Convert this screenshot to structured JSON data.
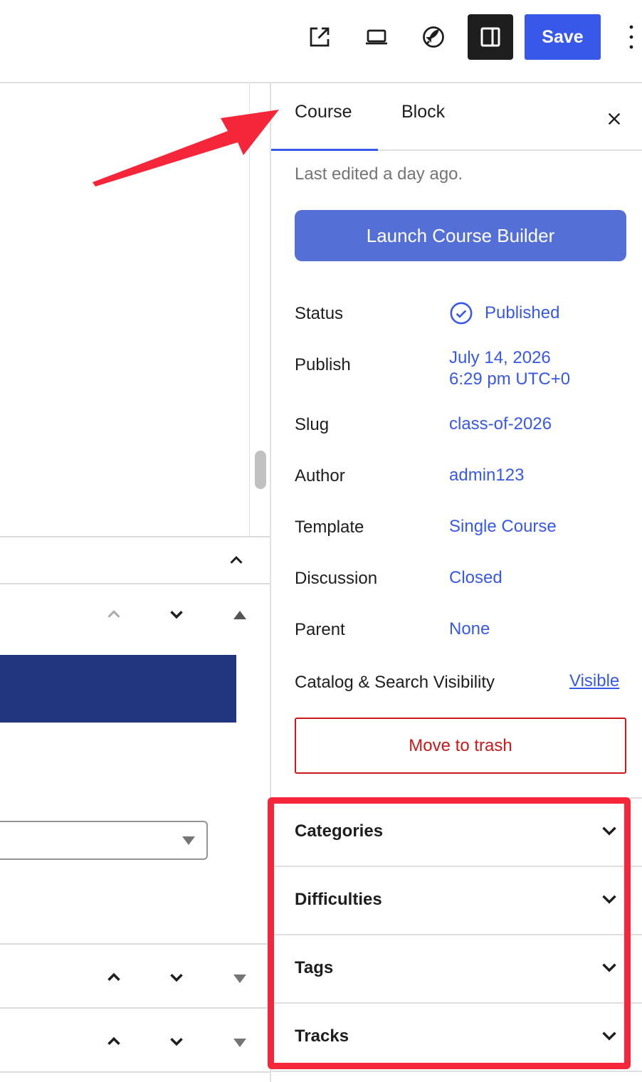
{
  "toolbar": {
    "view_icon": "external-link-icon",
    "preview_icon": "laptop-icon",
    "launchpad_icon": "rocket-icon",
    "settings_icon": "sidebar-toggle-icon",
    "save_label": "Save",
    "more_icon": "vertical-ellipsis-icon"
  },
  "sidebar": {
    "tabs": [
      {
        "label": "Course",
        "active": true
      },
      {
        "label": "Block",
        "active": false
      }
    ],
    "close_icon": "close-icon",
    "last_edited": "Last edited a day ago.",
    "launch_label": "Launch Course Builder",
    "properties": {
      "status": {
        "label": "Status",
        "value": "Published"
      },
      "publish": {
        "label": "Publish",
        "date": "July 14, 2026",
        "time": "6:29 pm UTC+0"
      },
      "slug": {
        "label": "Slug",
        "value": "class-of-2026"
      },
      "author": {
        "label": "Author",
        "value": "admin123"
      },
      "template": {
        "label": "Template",
        "value": "Single Course"
      },
      "discussion": {
        "label": "Discussion",
        "value": "Closed"
      },
      "parent": {
        "label": "Parent",
        "value": "None"
      },
      "visibility": {
        "label": "Catalog & Search Visibility",
        "value": "Visible"
      }
    },
    "trash_label": "Move to trash",
    "panels": [
      {
        "title": "Categories"
      },
      {
        "title": "Difficulties"
      },
      {
        "title": "Tags"
      },
      {
        "title": "Tracks"
      }
    ]
  },
  "colors": {
    "accent": "#3858e9",
    "launch_button": "#5470d6",
    "danger": "#cc1818",
    "annotation": "#f5263a",
    "block_bar": "#21367e"
  }
}
